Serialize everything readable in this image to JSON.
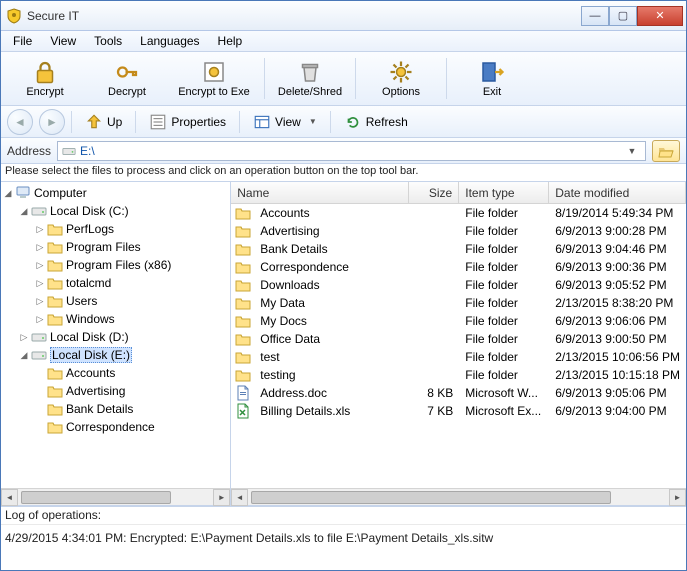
{
  "window": {
    "title": "Secure IT"
  },
  "menu": [
    "File",
    "View",
    "Tools",
    "Languages",
    "Help"
  ],
  "toolbar": {
    "encrypt": "Encrypt",
    "decrypt": "Decrypt",
    "encrypt_exe": "Encrypt to Exe",
    "delete_shred": "Delete/Shred",
    "options": "Options",
    "exit": "Exit"
  },
  "nav": {
    "up": "Up",
    "properties": "Properties",
    "view": "View",
    "refresh": "Refresh"
  },
  "address": {
    "label": "Address",
    "value": "E:\\"
  },
  "instruction": "Please select the files to process and click on an operation button on the top tool bar.",
  "tree": {
    "root": "Computer",
    "c": "Local Disk (C:)",
    "c_children": [
      "PerfLogs",
      "Program Files",
      "Program Files (x86)",
      "totalcmd",
      "Users",
      "Windows"
    ],
    "d": "Local Disk (D:)",
    "e": "Local Disk (E:)",
    "e_children": [
      "Accounts",
      "Advertising",
      "Bank Details",
      "Correspondence"
    ]
  },
  "columns": {
    "name": "Name",
    "size": "Size",
    "type": "Item type",
    "date": "Date modified"
  },
  "files": [
    {
      "icon": "folder",
      "name": "Accounts",
      "size": "",
      "type": "File folder",
      "date": "8/19/2014 5:49:34 PM"
    },
    {
      "icon": "folder",
      "name": "Advertising",
      "size": "",
      "type": "File folder",
      "date": "6/9/2013 9:00:28 PM"
    },
    {
      "icon": "folder",
      "name": "Bank Details",
      "size": "",
      "type": "File folder",
      "date": "6/9/2013 9:04:46 PM"
    },
    {
      "icon": "folder",
      "name": "Correspondence",
      "size": "",
      "type": "File folder",
      "date": "6/9/2013 9:00:36 PM"
    },
    {
      "icon": "folder",
      "name": "Downloads",
      "size": "",
      "type": "File folder",
      "date": "6/9/2013 9:05:52 PM"
    },
    {
      "icon": "folder",
      "name": "My Data",
      "size": "",
      "type": "File folder",
      "date": "2/13/2015 8:38:20 PM"
    },
    {
      "icon": "folder",
      "name": "My Docs",
      "size": "",
      "type": "File folder",
      "date": "6/9/2013 9:06:06 PM"
    },
    {
      "icon": "folder",
      "name": "Office Data",
      "size": "",
      "type": "File folder",
      "date": "6/9/2013 9:00:50 PM"
    },
    {
      "icon": "folder",
      "name": "test",
      "size": "",
      "type": "File folder",
      "date": "2/13/2015 10:06:56 PM"
    },
    {
      "icon": "folder",
      "name": "testing",
      "size": "",
      "type": "File folder",
      "date": "2/13/2015 10:15:18 PM"
    },
    {
      "icon": "doc",
      "name": "Address.doc",
      "size": "8 KB",
      "type": "Microsoft W...",
      "date": "6/9/2013 9:05:06 PM"
    },
    {
      "icon": "xls",
      "name": "Billing Details.xls",
      "size": "7 KB",
      "type": "Microsoft Ex...",
      "date": "6/9/2013 9:04:00 PM"
    }
  ],
  "log": {
    "header": "Log of operations:",
    "line": "4/29/2015 4:34:01 PM: Encrypted: E:\\Payment Details.xls to file E:\\Payment Details_xls.sitw"
  }
}
